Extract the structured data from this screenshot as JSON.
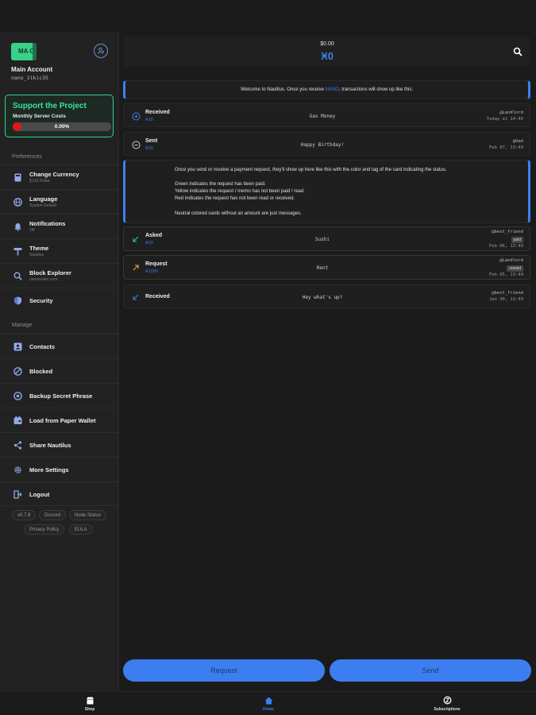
{
  "sidebar": {
    "logo_text": "MA C",
    "account_name": "Main Account",
    "account_handle": "nano_1tkic35",
    "support": {
      "title": "Support the Project",
      "subtitle": "Monthly Server Costs",
      "progress_text": "0.00%",
      "progress_fraction": 0.0
    },
    "preferences_label": "Preferences",
    "preferences": [
      {
        "label": "Change Currency",
        "sub": "$ US Dollar",
        "icon": "currency-icon"
      },
      {
        "label": "Language",
        "sub": "System Default",
        "icon": "globe-icon"
      },
      {
        "label": "Notifications",
        "sub": "Off",
        "icon": "bell-icon"
      },
      {
        "label": "Theme",
        "sub": "Nautilus",
        "icon": "paint-roller-icon"
      },
      {
        "label": "Block Explorer",
        "sub": "nanolooker.com",
        "icon": "search-icon"
      },
      {
        "label": "Security",
        "sub": "",
        "icon": "shield-icon"
      }
    ],
    "manage_label": "Manage",
    "manage": [
      {
        "label": "Contacts",
        "icon": "contacts-icon"
      },
      {
        "label": "Blocked",
        "icon": "blocked-icon"
      },
      {
        "label": "Backup Secret Phrase",
        "icon": "backup-icon"
      },
      {
        "label": "Load from Paper Wallet",
        "icon": "paper-wallet-icon"
      },
      {
        "label": "Share Nautilus",
        "icon": "share-icon"
      },
      {
        "label": "More Settings",
        "icon": "gear-icon"
      },
      {
        "label": "Logout",
        "icon": "logout-icon"
      }
    ],
    "chips": [
      "v0.7.8",
      "Discord",
      "Node Status",
      "Privacy Policy",
      "EULA"
    ]
  },
  "header": {
    "fiat": "$0.00",
    "balance": "Ӿ0"
  },
  "welcome": {
    "before": "Welcome to Nautilus. Once you receive ",
    "link": "NANO",
    "after": ", transactions will show up like this:"
  },
  "feed": [
    {
      "title": "Received",
      "amount": "Ӿ10",
      "message": "Gas Money",
      "who": "@Landlord",
      "date": "Today at 14:49",
      "tag": ""
    },
    {
      "title": "Sent",
      "amount": "Ӿ10",
      "message": "Happy Birthday!",
      "who": "@dad",
      "date": "Feb 07, 13:49",
      "tag": ""
    }
  ],
  "explanation": [
    "Once you send or receive a payment request, they'll show up here like this with the color and tag of the card indicating the status.",
    "",
    "Green indicates the request has been paid.",
    "Yellow indicates the request / memo has not been paid / read.",
    "Red indicates the request has not been read or received.",
    "",
    "Neutral colored cards without an amount are just messages."
  ],
  "requests": [
    {
      "title": "Asked",
      "amount": "Ӿ10",
      "message": "Sushi",
      "who": "@best_friend",
      "tag": "paid",
      "date": "Feb 06, 13:49"
    },
    {
      "title": "Request",
      "amount": "Ӿ1000",
      "message": "Rent",
      "who": "@Landlord",
      "tag": "unpaid",
      "date": "Feb 05, 13:49"
    },
    {
      "title": "Received",
      "amount": "",
      "message": "Hey what's up?",
      "who": "@best_friend",
      "tag": "",
      "date": "Jan 30, 13:49"
    }
  ],
  "actions": {
    "request": "Request",
    "send": "Send"
  },
  "bottom_nav": {
    "shop": "Shop",
    "home": "Home",
    "subscriptions": "Subscriptions"
  },
  "colors": {
    "accent": "#3c7ef0",
    "support_green": "#39e39a",
    "progress_red": "#e01818"
  }
}
